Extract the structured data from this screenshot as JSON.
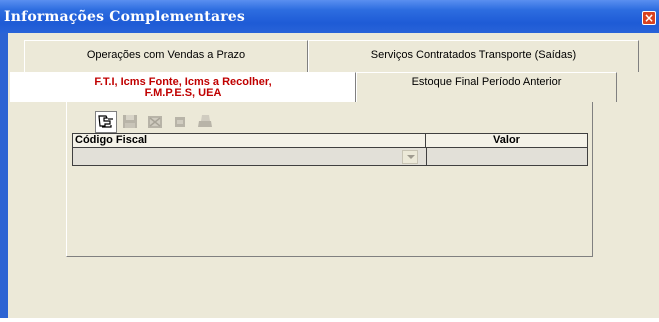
{
  "window": {
    "title": "Informações Complementares"
  },
  "tabs_row1": [
    {
      "label": "Operações com Vendas a Prazo"
    },
    {
      "label": "Serviços Contratados Transporte (Saídas)"
    }
  ],
  "tabs_row2": [
    {
      "label_line1": "F.T.I, Icms Fonte, Icms a Recolher,",
      "label_line2": "F.M.P.E.S, UEA"
    },
    {
      "label": "Estoque Final Período Anterior"
    }
  ],
  "toolbar": {
    "icons": [
      "new-record-icon",
      "save-icon",
      "delete-icon",
      "undo-icon",
      "print-icon"
    ]
  },
  "grid": {
    "columns": [
      "Código Fiscal",
      "Valor"
    ],
    "rows": [
      {
        "codigo_fiscal": "",
        "valor": ""
      }
    ]
  },
  "colors": {
    "titlebar": "#2d6de0",
    "active_tab_text": "#c00000",
    "window_bg": "#ece9d8"
  }
}
